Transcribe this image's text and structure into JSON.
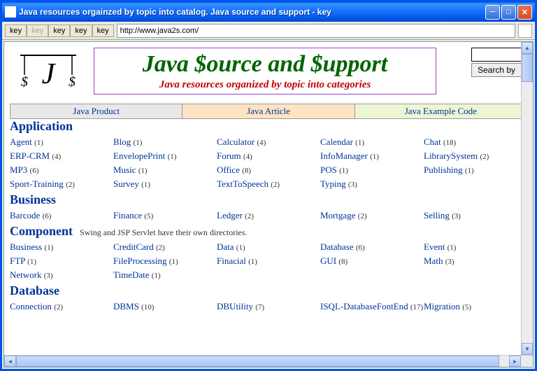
{
  "window": {
    "title": "Java resources orgainzed by topic into catalog. Java source and support - key"
  },
  "toolbar": {
    "tabs": [
      "key",
      "key",
      "key",
      "key",
      "key"
    ],
    "url": "http://www.java2s.com/"
  },
  "banner": {
    "title": "Java $ource and $upport",
    "subtitle": "Java resources organized by topic into categories",
    "search_button": "Search by"
  },
  "nav_tabs": [
    "Java Product",
    "Java Article",
    "Java Example Code"
  ],
  "sections": [
    {
      "name": "Application",
      "note": "",
      "items": [
        {
          "label": "Agent",
          "count": 1
        },
        {
          "label": "Blog",
          "count": 1
        },
        {
          "label": "Calculator",
          "count": 4
        },
        {
          "label": "Calendar",
          "count": 1
        },
        {
          "label": "Chat",
          "count": 18
        },
        {
          "label": "ERP-CRM",
          "count": 4
        },
        {
          "label": "EnvelopePrint",
          "count": 1
        },
        {
          "label": "Forum",
          "count": 4
        },
        {
          "label": "InfoManager",
          "count": 1
        },
        {
          "label": "LibrarySystem",
          "count": 2
        },
        {
          "label": "MP3",
          "count": 6
        },
        {
          "label": "Music",
          "count": 1
        },
        {
          "label": "Office",
          "count": 8
        },
        {
          "label": "POS",
          "count": 1
        },
        {
          "label": "Publishing",
          "count": 1
        },
        {
          "label": "Sport-Training",
          "count": 2
        },
        {
          "label": "Survey",
          "count": 1
        },
        {
          "label": "TextToSpeech",
          "count": 2
        },
        {
          "label": "Typing",
          "count": 3
        },
        {
          "label": "",
          "count": null
        }
      ]
    },
    {
      "name": "Business",
      "note": "",
      "items": [
        {
          "label": "Barcode",
          "count": 6
        },
        {
          "label": "Finance",
          "count": 5
        },
        {
          "label": "Ledger",
          "count": 2
        },
        {
          "label": "Mortgage",
          "count": 2
        },
        {
          "label": "Selling",
          "count": 3
        }
      ]
    },
    {
      "name": "Component",
      "note": "Swing and JSP Servlet have their own directories.",
      "items": [
        {
          "label": "Business",
          "count": 1
        },
        {
          "label": "CreditCard",
          "count": 2
        },
        {
          "label": "Data",
          "count": 1
        },
        {
          "label": "Database",
          "count": 6
        },
        {
          "label": "Event",
          "count": 1
        },
        {
          "label": "FTP",
          "count": 1
        },
        {
          "label": "FileProcessing",
          "count": 1
        },
        {
          "label": "Finacial",
          "count": 1
        },
        {
          "label": "GUI",
          "count": 8
        },
        {
          "label": "Math",
          "count": 3
        },
        {
          "label": "Network",
          "count": 3
        },
        {
          "label": "TimeDate",
          "count": 1
        },
        {
          "label": "",
          "count": null
        },
        {
          "label": "",
          "count": null
        },
        {
          "label": "",
          "count": null
        }
      ]
    },
    {
      "name": "Database",
      "note": "",
      "items": [
        {
          "label": "Connection",
          "count": 2
        },
        {
          "label": "DBMS",
          "count": 10
        },
        {
          "label": "DBUtility",
          "count": 7
        },
        {
          "label": "ISQL-DatabaseFontEnd",
          "count": 17
        },
        {
          "label": "Migration",
          "count": 5
        }
      ]
    }
  ]
}
